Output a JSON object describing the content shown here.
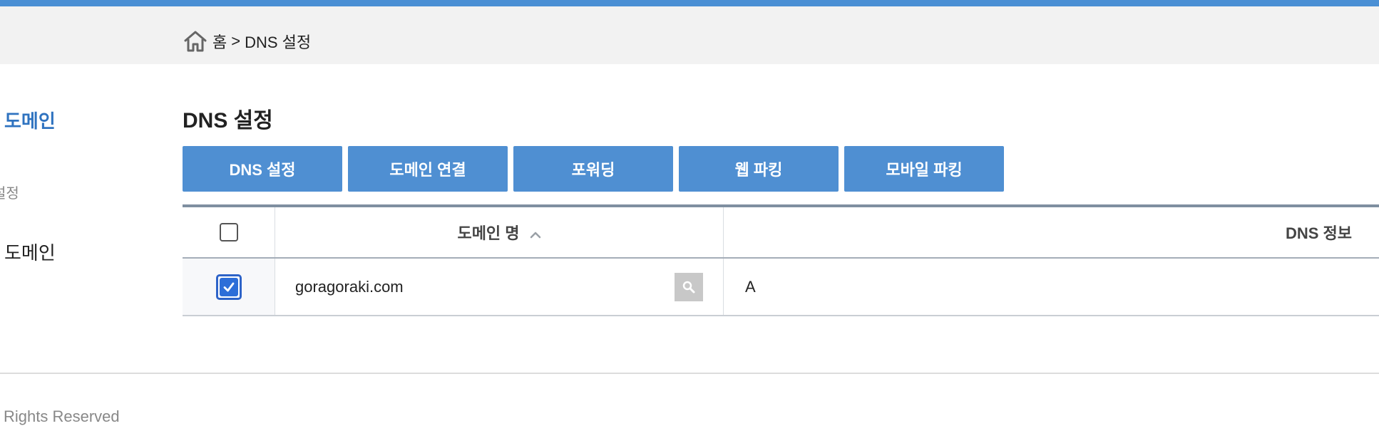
{
  "breadcrumb": {
    "home_icon": "home-icon",
    "home_label": "홈",
    "separator": ">",
    "current": "DNS 설정"
  },
  "sidebar": {
    "title": "도메인",
    "sub_label": "설정",
    "item_label": "도메인"
  },
  "page": {
    "title": "DNS 설정"
  },
  "tabs": [
    {
      "label": "DNS 설정"
    },
    {
      "label": "도메인 연결"
    },
    {
      "label": "포워딩"
    },
    {
      "label": "웹 파킹"
    },
    {
      "label": "모바일 파킹"
    }
  ],
  "table": {
    "headers": {
      "domain": "도메인 명",
      "dns": "DNS 정보"
    },
    "rows": [
      {
        "checked": true,
        "domain": "goragoraki.com",
        "dns": "A"
      }
    ]
  },
  "footer": {
    "text": "l Rights Reserved"
  },
  "colors": {
    "accent": "#4f8fd2",
    "sidebar_title": "#2f73c0",
    "top_line": "#4a8fd4"
  }
}
